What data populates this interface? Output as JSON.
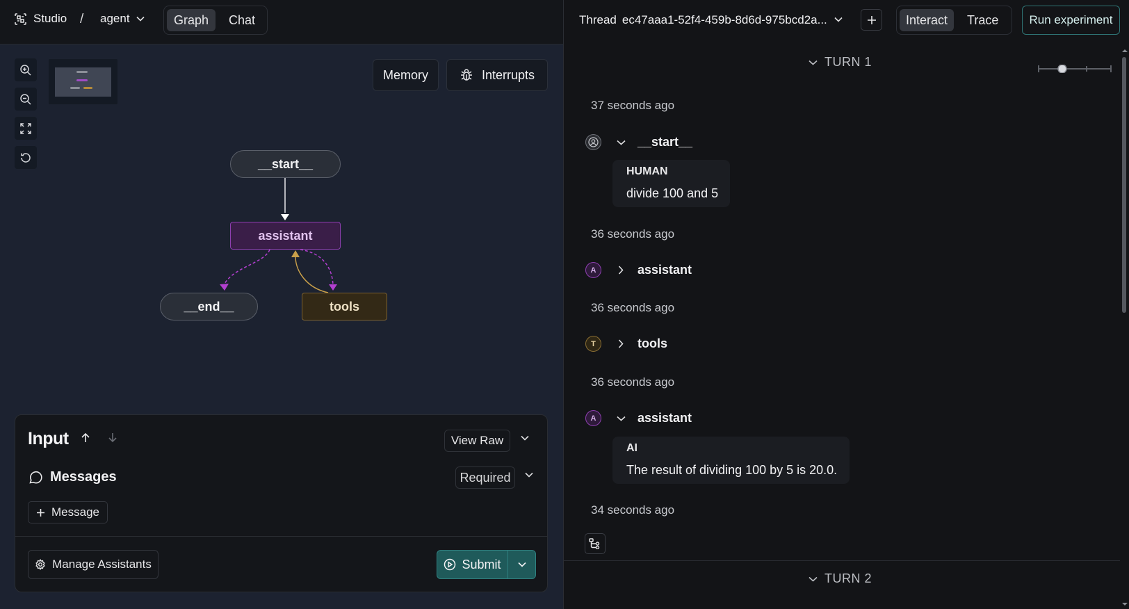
{
  "header": {
    "app_name": "Studio",
    "separator": "/",
    "graph_name": "agent",
    "view_tabs": [
      {
        "label": "Graph",
        "active": true
      },
      {
        "label": "Chat",
        "active": false
      }
    ]
  },
  "canvas": {
    "memory_label": "Memory",
    "interrupts_label": "Interrupts",
    "zoom_tools": [
      "zoom-in-icon",
      "zoom-out-icon",
      "fit-view-icon",
      "reset-icon"
    ],
    "nodes": {
      "start": "__start__",
      "assistant": "assistant",
      "end": "__end__",
      "tools": "tools"
    },
    "colors": {
      "assistant": "#8e3fb0",
      "tools": "#7b6131",
      "conditional_edge": "#b23fcf",
      "tool_return_edge": "#c9a04a"
    }
  },
  "input_panel": {
    "title": "Input",
    "view_raw_label": "View Raw",
    "messages_label": "Messages",
    "required_label": "Required",
    "add_message_label": "Message",
    "manage_assistants_label": "Manage Assistants",
    "submit_label": "Submit"
  },
  "thread": {
    "label": "Thread",
    "id": "ec47aaa1-52f4-459b-8d6d-975bcd2a...",
    "mode_tabs": [
      {
        "label": "Interact",
        "active": true
      },
      {
        "label": "Trace",
        "active": false
      }
    ],
    "run_experiment_label": "Run experiment",
    "turns": [
      {
        "label": "TURN 1",
        "entries": [
          {
            "timestamp": "37 seconds ago",
            "avatar": "",
            "node": "__start__",
            "expanded": true,
            "role": "HUMAN",
            "content": "divide 100 and 5"
          },
          {
            "timestamp": "36 seconds ago",
            "avatar": "A",
            "node": "assistant",
            "expanded": false
          },
          {
            "timestamp": "36 seconds ago",
            "avatar": "T",
            "node": "tools",
            "expanded": false
          },
          {
            "timestamp": "36 seconds ago",
            "avatar": "A",
            "node": "assistant",
            "expanded": true,
            "role": "AI",
            "content": "The result of dividing 100 by 5 is 20.0."
          }
        ],
        "final_timestamp": "34 seconds ago"
      },
      {
        "label": "TURN 2"
      }
    ]
  }
}
